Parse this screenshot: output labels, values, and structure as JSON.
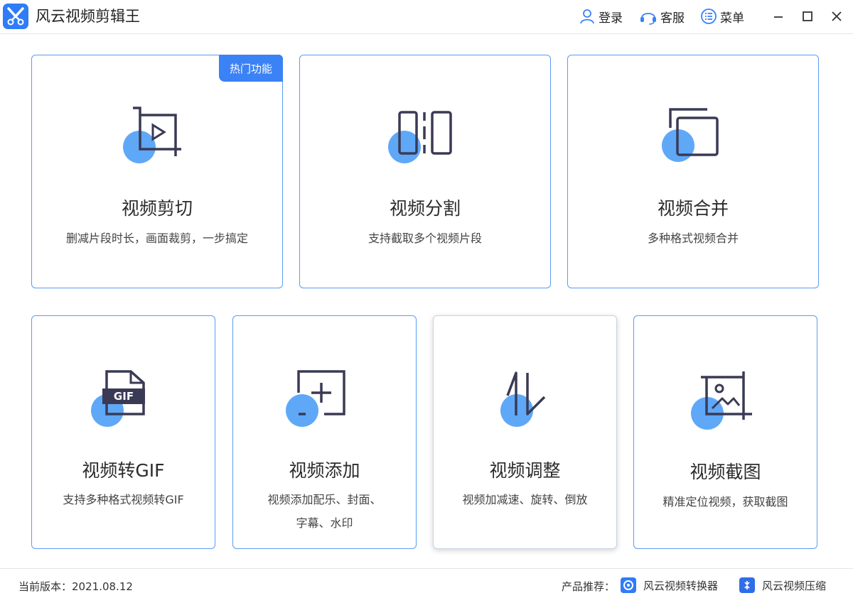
{
  "app": {
    "title": "风云视频剪辑王"
  },
  "toolbar": {
    "login": "登录",
    "service": "客服",
    "menu": "菜单"
  },
  "cards": [
    {
      "title": "视频剪切",
      "desc": "删减片段时长，画面裁剪，一步搞定",
      "badge": "热门功能"
    },
    {
      "title": "视频分割",
      "desc": "支持截取多个视频片段"
    },
    {
      "title": "视频合并",
      "desc": "多种格式视频合并"
    },
    {
      "title": "视频转GIF",
      "desc": "支持多种格式视频转GIF",
      "icon_text": "GIF"
    },
    {
      "title": "视频添加",
      "desc_line1": "视频添加配乐、封面、",
      "desc_line2": "字幕、水印"
    },
    {
      "title": "视频调整",
      "desc": "视频加减速、旋转、倒放"
    },
    {
      "title": "视频截图",
      "desc": "精准定位视频，获取截图"
    }
  ],
  "footer": {
    "version_label": "当前版本：",
    "version": "2021.08.12",
    "products_label": "产品推荐：",
    "products": [
      {
        "name": "风云视频转换器"
      },
      {
        "name": "风云视频压缩"
      }
    ]
  },
  "colors": {
    "accent": "#3a82f5",
    "dot": "#5fa8f8",
    "icon_stroke": "#3a3a55"
  }
}
